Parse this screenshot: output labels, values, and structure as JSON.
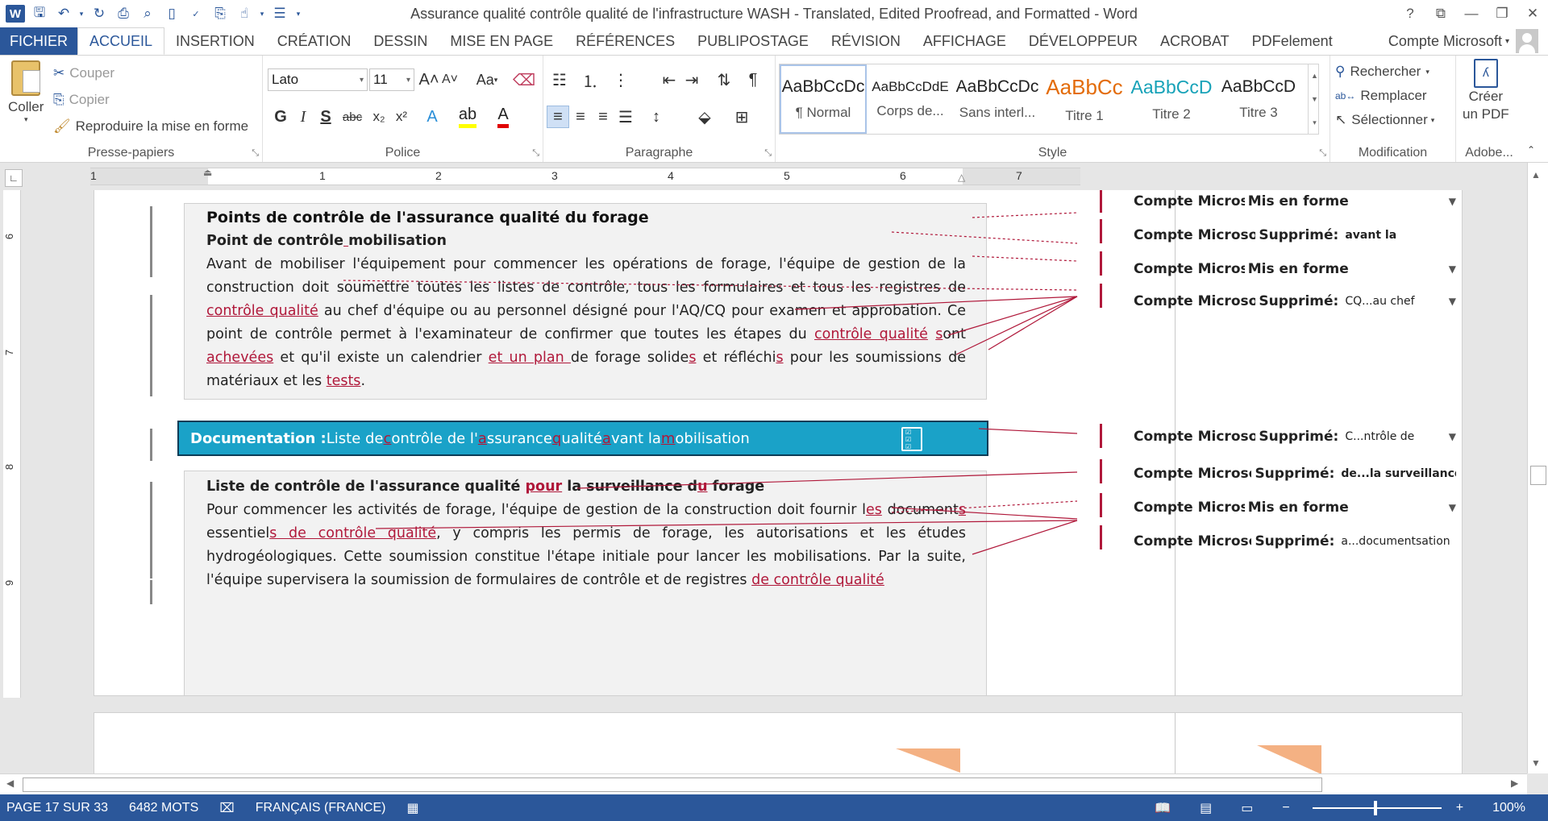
{
  "window": {
    "title": "Assurance qualité  contrôle qualité de l'infrastructure WASH - Translated, Edited Proofread, and Formatted - Word",
    "help": "?",
    "controls": [
      "restore-ribbon",
      "minimize",
      "maximize",
      "close"
    ]
  },
  "tabs": [
    "FICHIER",
    "ACCUEIL",
    "INSERTION",
    "CRÉATION",
    "DESSIN",
    "MISE EN PAGE",
    "RÉFÉRENCES",
    "PUBLIPOSTAGE",
    "RÉVISION",
    "AFFICHAGE",
    "DÉVELOPPEUR",
    "ACROBAT",
    "PDFelement"
  ],
  "active_tab": "ACCUEIL",
  "account": "Compte Microsoft",
  "ribbon": {
    "clipboard": {
      "paste": "Coller",
      "cut": "Couper",
      "copy": "Copier",
      "format_painter": "Reproduire la mise en forme",
      "label": "Presse-papiers"
    },
    "font": {
      "name": "Lato",
      "size": "11",
      "label": "Police",
      "bold": "G",
      "italic": "I",
      "underline": "S",
      "strike": "abc",
      "sub": "x₂",
      "sup": "x²",
      "case": "Aa"
    },
    "paragraph": {
      "label": "Paragraphe"
    },
    "styles": {
      "label": "Style",
      "items": [
        {
          "preview": "AaBbCcDc",
          "name": "¶ Normal",
          "color": "#222"
        },
        {
          "preview": "AaBbCcDdE",
          "name": "Corps de...",
          "color": "#222"
        },
        {
          "preview": "AaBbCcDc",
          "name": "Sans interl...",
          "color": "#222"
        },
        {
          "preview": "AaBbCc",
          "name": "Titre 1",
          "color": "#e36c0a"
        },
        {
          "preview": "AaBbCcD",
          "name": "Titre 2",
          "color": "#17a2b8"
        },
        {
          "preview": "AaBbCcD",
          "name": "Titre 3",
          "color": "#222"
        }
      ]
    },
    "editing": {
      "find": "Rechercher",
      "replace": "Remplacer",
      "select": "Sélectionner",
      "label": "Modification"
    },
    "adobe": {
      "create": "Créer",
      "create2": "un PDF",
      "label": "Adobe..."
    }
  },
  "ruler": {
    "numbers": [
      "1",
      "1",
      "2",
      "3",
      "4",
      "5",
      "6",
      "7"
    ]
  },
  "vruler": {
    "numbers": [
      "6",
      "7",
      "8",
      "9"
    ]
  },
  "doc": {
    "heading1": "Points de contrôle de l'assurance qualité du forage",
    "heading2": "Point de contrôle",
    "heading2b": "mobilisation",
    "para1_a": "Avant de mobiliser l'équipement pour commencer les opérations de forage, l'équipe de gestion de la construction doit soumettre toutes les listes de contrôle, tous les formulaires et tous les registres de ",
    "para1_ins1": "contrôle qualité",
    "para1_b": " au chef d'équipe ou au personnel désigné pour l'AQ/CQ pour examen et approbation. Ce point de contrôle permet à l'examinateur de confirmer que toutes les étapes du ",
    "para1_ins2": "contrôle qualité",
    "para1_ins3": "s",
    "para1_c": "ont ",
    "para1_ins4": "achevées",
    "para1_d": " et qu'il existe un calendrier ",
    "para1_ins5": "et un plan ",
    "para1_e": "de forage solide",
    "para1_ins6": "s",
    "para1_f": " et réfléchi",
    "para1_ins7": "s",
    "para1_g": " pour les soumissions de matériaux et les ",
    "para1_ins8": "tests",
    "para1_h": ".",
    "doc_label_bold": "Documentation :",
    "doc_label_1": " Liste de ",
    "doc_label_c": "c",
    "doc_label_2": "ontrôle de l'",
    "doc_label_a": "a",
    "doc_label_3": "ssurance ",
    "doc_label_q": "q",
    "doc_label_4": "ualité ",
    "doc_label_a2": "a",
    "doc_label_5": "vant la ",
    "doc_label_m": "m",
    "doc_label_6": "obilisation",
    "heading3a": "Liste de contrôle de l'assurance qualité ",
    "heading3_ins": "pour",
    "heading3b": " la surveillance d",
    "heading3_ins2": "u",
    "heading3c": " forage",
    "para2_a": "Pour commencer les activités de forage, l'équipe de gestion de la construction doit fournir l",
    "para2_ins1": "es",
    "para2_b": " document",
    "para2_ins2": "s",
    "para2_c": " essentiel",
    "para2_ins3": "s de contrôle qualité",
    "para2_d": ", y compris les permis de forage, les autorisations et les études hydrogéologiques. Cette soumission constitue l'étape initiale pour lancer les mobilisations. Par la suite, l'équipe supervisera la soumission de formulaires de contrôle et de registres ",
    "para2_ins4": "de contrôle qualité"
  },
  "balloons": [
    {
      "author": "Compte Microso",
      "action": "Mis en forme",
      "detail": ""
    },
    {
      "author": "Compte Microso",
      "action": "Supprimé:",
      "detail": "avant la"
    },
    {
      "author": "Compte Microso",
      "action": "Mis en forme",
      "detail": ""
    },
    {
      "author": "Compte Microso",
      "action": "Supprimé:",
      "detail": "CQ...au chef"
    },
    {
      "author": "Compte Microso",
      "action": "Supprimé:",
      "detail": "C...ntrôle de"
    },
    {
      "author": "Compte Microso",
      "action": "Supprimé:",
      "detail": "de...la surveillance"
    },
    {
      "author": "Compte Microso",
      "action": "Mis en forme",
      "detail": ""
    },
    {
      "author": "Compte Microso",
      "action": "Supprimé:",
      "detail": "a...documentsation"
    }
  ],
  "status": {
    "page": "PAGE 17 SUR 33",
    "words": "6482 MOTS",
    "language": "FRANÇAIS (FRANCE)",
    "zoom": "100%"
  },
  "colors": {
    "accent": "#2b579a",
    "revision": "#b0183a",
    "label_bg": "#1aa2c8"
  }
}
